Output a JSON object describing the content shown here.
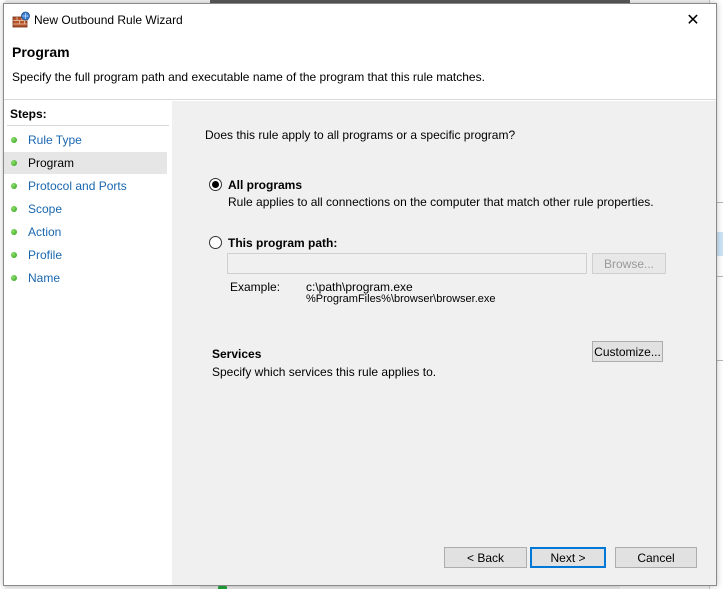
{
  "window": {
    "title": "New Outbound Rule Wizard",
    "close_glyph": "✕"
  },
  "header": {
    "title": "Program",
    "description": "Specify the full program path and executable name of the program that this rule matches."
  },
  "steps": {
    "label": "Steps:",
    "items": [
      {
        "label": "Rule Type"
      },
      {
        "label": "Program"
      },
      {
        "label": "Protocol and Ports"
      },
      {
        "label": "Scope"
      },
      {
        "label": "Action"
      },
      {
        "label": "Profile"
      },
      {
        "label": "Name"
      }
    ],
    "current_index": 1
  },
  "content": {
    "question": "Does this rule apply to all programs or a specific program?",
    "all_programs": {
      "label": "All programs",
      "description": "Rule applies to all connections on the computer that match other rule properties.",
      "selected": true
    },
    "program_path": {
      "label": "This program path:",
      "value": "",
      "selected": false,
      "browse_label": "Browse...",
      "example_label": "Example:",
      "examples": [
        "c:\\path\\program.exe",
        "%ProgramFiles%\\browser\\browser.exe"
      ]
    },
    "services": {
      "title": "Services",
      "description": "Specify which services this rule applies to.",
      "customize_label": "Customize..."
    }
  },
  "footer": {
    "back_label": "< Back",
    "next_label": "Next >",
    "cancel_label": "Cancel"
  },
  "icons": {
    "window_icon": "firewall-icon",
    "step_bullet": "green-bullet-icon"
  },
  "colors": {
    "link": "#1a67b0",
    "content_bg": "#f0f0f0",
    "focus_border": "#0078d7"
  }
}
